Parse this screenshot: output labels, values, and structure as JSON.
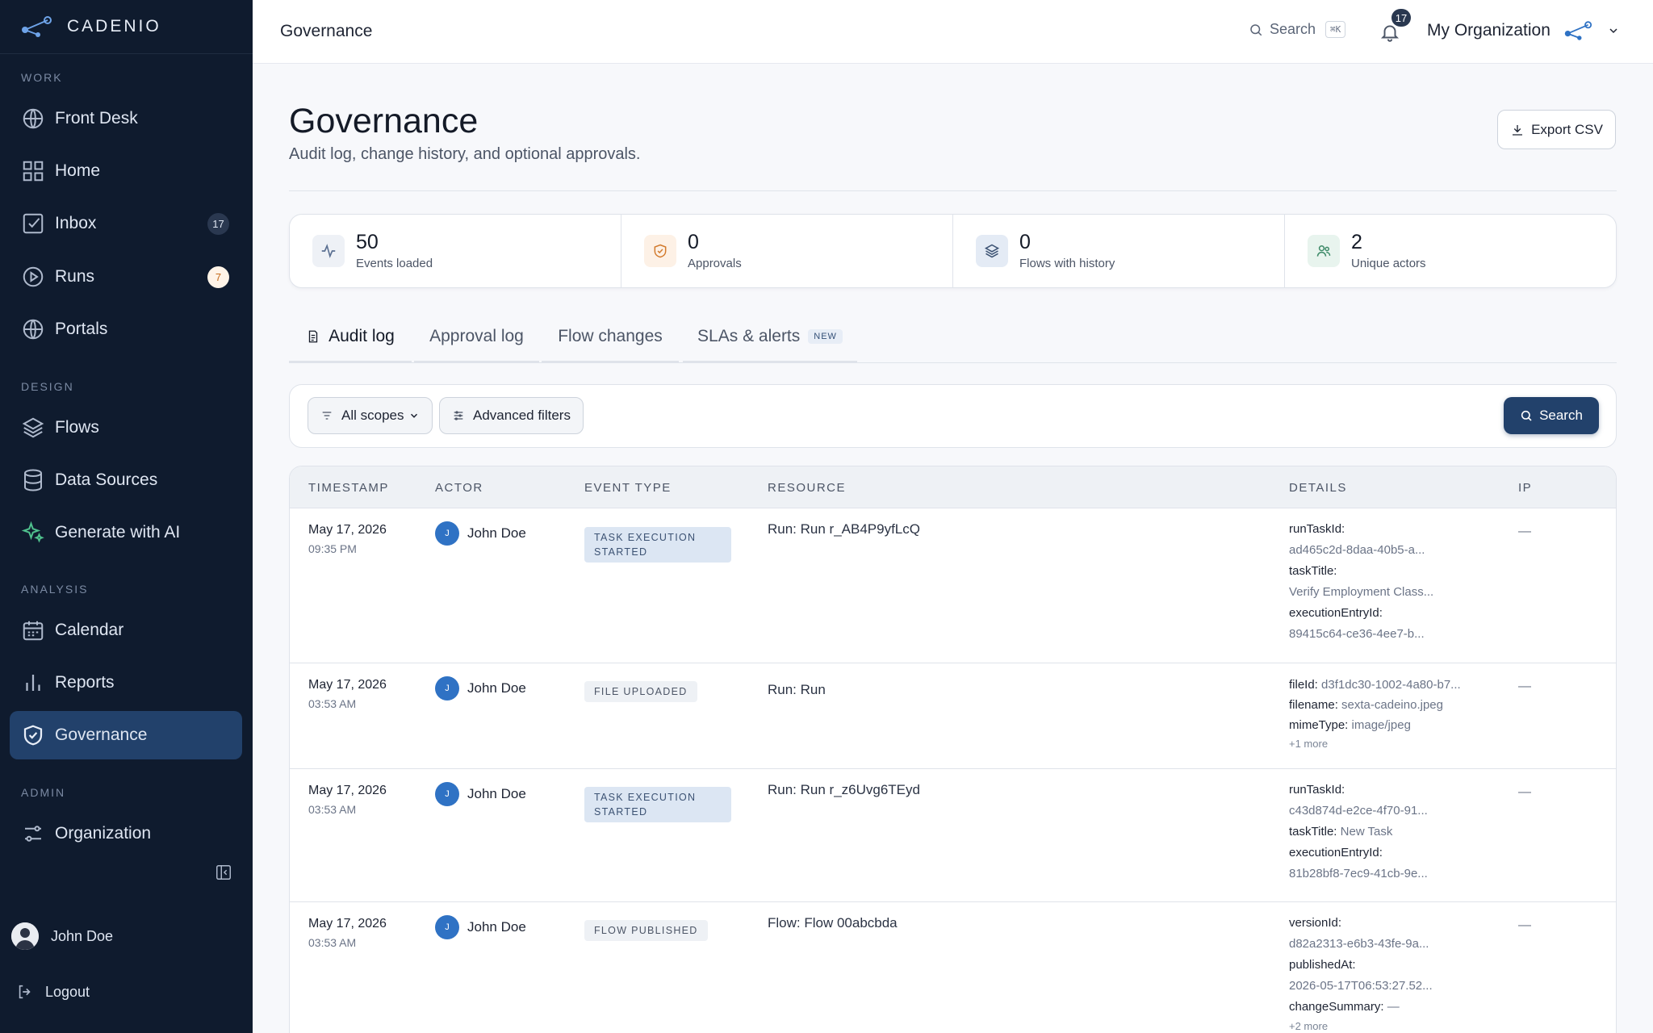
{
  "brand": {
    "name": "CADENIO"
  },
  "sidebar": {
    "sections": [
      "WORK",
      "DESIGN",
      "ANALYSIS",
      "ADMIN"
    ],
    "items": [
      {
        "label": "Front Desk",
        "icon": "globe-icon"
      },
      {
        "label": "Home",
        "icon": "grid-icon"
      },
      {
        "label": "Inbox",
        "icon": "checkbox-icon",
        "badge": "17"
      },
      {
        "label": "Runs",
        "icon": "play-circle-icon",
        "badge": "7"
      },
      {
        "label": "Portals",
        "icon": "globe-icon"
      },
      {
        "label": "Flows",
        "icon": "layers-icon"
      },
      {
        "label": "Data Sources",
        "icon": "database-icon"
      },
      {
        "label": "Generate with AI",
        "icon": "sparkle-icon"
      },
      {
        "label": "Calendar",
        "icon": "calendar-icon"
      },
      {
        "label": "Reports",
        "icon": "bar-chart-icon"
      },
      {
        "label": "Governance",
        "icon": "shield-icon"
      },
      {
        "label": "Organization",
        "icon": "settings-sliders-icon"
      }
    ],
    "user": {
      "name": "John Doe"
    },
    "logout_label": "Logout"
  },
  "topbar": {
    "title": "Governance",
    "search_label": "Search",
    "shortcut": "⌘K",
    "notification_count": "17",
    "org_name": "My Organization"
  },
  "page": {
    "title": "Governance",
    "subtitle": "Audit log, change history, and optional approvals.",
    "export_label": "Export CSV"
  },
  "stats": [
    {
      "value": "50",
      "label": "Events loaded",
      "icon": "activity-icon",
      "color": "#5a6f91",
      "bg": "#eef1f6"
    },
    {
      "value": "0",
      "label": "Approvals",
      "icon": "shield-check-icon",
      "color": "#d27a2c",
      "bg": "#fdf1e6"
    },
    {
      "value": "0",
      "label": "Flows with history",
      "icon": "layers-icon",
      "color": "#3c5273",
      "bg": "#e4ebf5"
    },
    {
      "value": "2",
      "label": "Unique actors",
      "icon": "users-icon",
      "color": "#3d8a68",
      "bg": "#e8f4ee"
    }
  ],
  "tabs": [
    {
      "label": "Audit log"
    },
    {
      "label": "Approval log"
    },
    {
      "label": "Flow changes"
    },
    {
      "label": "SLAs & alerts",
      "pill": "NEW"
    }
  ],
  "filters": {
    "scope_label": "All scopes",
    "advanced_label": "Advanced filters",
    "search_label": "Search"
  },
  "table": {
    "columns": [
      "TIMESTAMP",
      "ACTOR",
      "EVENT TYPE",
      "RESOURCE",
      "DETAILS",
      "IP"
    ],
    "rows": [
      {
        "date": "May 17, 2026",
        "time": "09:35 PM",
        "actor_initial": "J",
        "actor": "John Doe",
        "event_line1": "TASK EXECUTION",
        "event_line2": "STARTED",
        "resource": "Run: Run r_AB4P9yfLcQ",
        "details": [
          {
            "key": "runTaskId:",
            "value": ""
          },
          {
            "key": "",
            "value": "ad465c2d-8daa-40b5-a..."
          },
          {
            "key": "taskTitle:",
            "value": ""
          },
          {
            "key": "",
            "value": "Verify Employment Class..."
          },
          {
            "key": "executionEntryId:",
            "value": ""
          },
          {
            "key": "",
            "value": "89415c64-ce36-4ee7-b..."
          }
        ],
        "more": "",
        "ip": "—"
      },
      {
        "date": "May 17, 2026",
        "time": "03:53 AM",
        "actor_initial": "J",
        "actor": "John Doe",
        "event_line1": "FILE UPLOADED",
        "event_line2": "",
        "resource": "Run: Run",
        "details": [
          {
            "key": "fileId:",
            "value": "d3f1dc30-1002-4a80-b7..."
          },
          {
            "key": "filename:",
            "value": "sexta-cadeino.jpeg"
          },
          {
            "key": "mimeType:",
            "value": "image/jpeg"
          }
        ],
        "more": "+1 more",
        "ip": "—"
      },
      {
        "date": "May 17, 2026",
        "time": "03:53 AM",
        "actor_initial": "J",
        "actor": "John Doe",
        "event_line1": "TASK EXECUTION",
        "event_line2": "STARTED",
        "resource": "Run: Run r_z6Uvg6TEyd",
        "details": [
          {
            "key": "runTaskId:",
            "value": ""
          },
          {
            "key": "",
            "value": "c43d874d-e2ce-4f70-91..."
          },
          {
            "key": "taskTitle:",
            "value": "New Task"
          },
          {
            "key": "executionEntryId:",
            "value": ""
          },
          {
            "key": "",
            "value": "81b28bf8-7ec9-41cb-9e..."
          }
        ],
        "more": "",
        "ip": "—"
      },
      {
        "date": "May 17, 2026",
        "time": "03:53 AM",
        "actor_initial": "J",
        "actor": "John Doe",
        "event_line1": "FLOW PUBLISHED",
        "event_line2": "",
        "resource": "Flow: Flow 00abcbda",
        "details": [
          {
            "key": "versionId:",
            "value": ""
          },
          {
            "key": "",
            "value": "d82a2313-e6b3-43fe-9a..."
          },
          {
            "key": "publishedAt:",
            "value": ""
          },
          {
            "key": "",
            "value": "2026-05-17T06:53:27.52..."
          },
          {
            "key": "changeSummary:",
            "value": "—"
          }
        ],
        "more": "+2 more",
        "ip": "—"
      }
    ]
  },
  "colors": {
    "sidebar_bg": "#0f1b2e",
    "active_bg": "#22416b",
    "accent": "#22416b"
  }
}
